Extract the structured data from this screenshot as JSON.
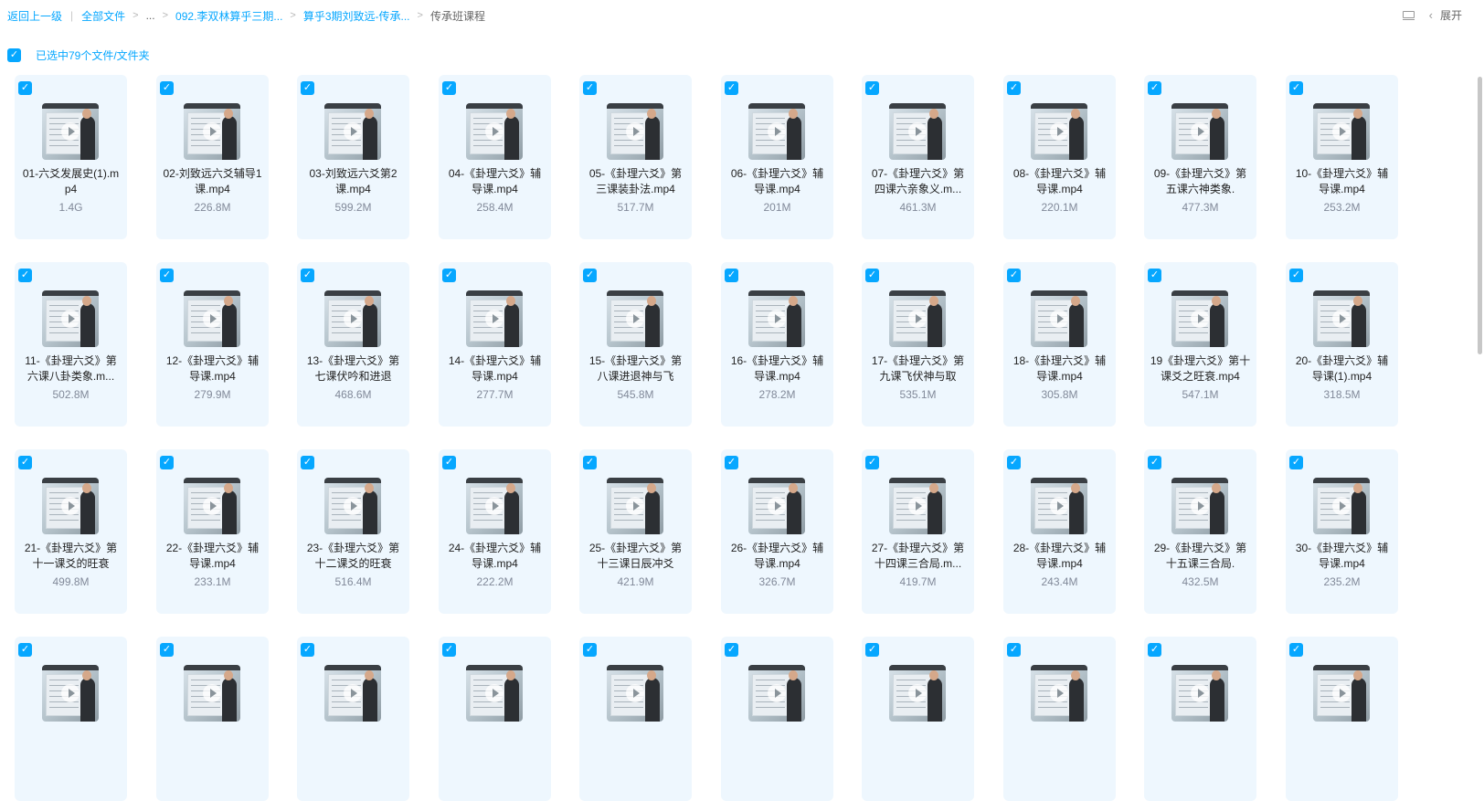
{
  "breadcrumb": {
    "back": "返回上一级",
    "root": "全部文件",
    "ellipsis": "...",
    "crumb1": "092.李双林算乎三期...",
    "crumb2": "算乎3期刘致远-传承...",
    "current": "传承班课程"
  },
  "toolbar": {
    "expand_label": "展开",
    "chevron": "‹",
    "check_mark": "✓"
  },
  "selection": {
    "label": "已选中79个文件/文件夹"
  },
  "files": [
    {
      "name": "01-六爻发展史(1).mp4",
      "size": "1.4G"
    },
    {
      "name": "02-刘致远六爻辅导1课.mp4",
      "size": "226.8M"
    },
    {
      "name": "03-刘致远六爻第2课.mp4",
      "size": "599.2M"
    },
    {
      "name": "04-《卦理六爻》辅导课.mp4",
      "size": "258.4M"
    },
    {
      "name": "05-《卦理六爻》第三课装卦法.mp4",
      "size": "517.7M"
    },
    {
      "name": "06-《卦理六爻》辅导课.mp4",
      "size": "201M"
    },
    {
      "name": "07-《卦理六爻》第四课六亲象义.m...",
      "size": "461.3M"
    },
    {
      "name": "08-《卦理六爻》辅导课.mp4",
      "size": "220.1M"
    },
    {
      "name": "09-《卦理六爻》第五课六神类象.",
      "size": "477.3M"
    },
    {
      "name": "10-《卦理六爻》辅导课.mp4",
      "size": "253.2M"
    },
    {
      "name": "11-《卦理六爻》第六课八卦类象.m...",
      "size": "502.8M"
    },
    {
      "name": "12-《卦理六爻》辅导课.mp4",
      "size": "279.9M"
    },
    {
      "name": "13-《卦理六爻》第七课伏吟和进退",
      "size": "468.6M"
    },
    {
      "name": "14-《卦理六爻》辅导课.mp4",
      "size": "277.7M"
    },
    {
      "name": "15-《卦理六爻》第八课进退神与飞",
      "size": "545.8M"
    },
    {
      "name": "16-《卦理六爻》辅导课.mp4",
      "size": "278.2M"
    },
    {
      "name": "17-《卦理六爻》第九课飞伏神与取",
      "size": "535.1M"
    },
    {
      "name": "18-《卦理六爻》辅导课.mp4",
      "size": "305.8M"
    },
    {
      "name": "19《卦理六爻》第十课爻之旺衰.mp4",
      "size": "547.1M"
    },
    {
      "name": "20-《卦理六爻》辅导课(1).mp4",
      "size": "318.5M"
    },
    {
      "name": "21-《卦理六爻》第十一课爻的旺衰",
      "size": "499.8M"
    },
    {
      "name": "22-《卦理六爻》辅导课.mp4",
      "size": "233.1M"
    },
    {
      "name": "23-《卦理六爻》第十二课爻的旺衰",
      "size": "516.4M"
    },
    {
      "name": "24-《卦理六爻》辅导课.mp4",
      "size": "222.2M"
    },
    {
      "name": "25-《卦理六爻》第十三课日辰冲爻",
      "size": "421.9M"
    },
    {
      "name": "26-《卦理六爻》辅导课.mp4",
      "size": "326.7M"
    },
    {
      "name": "27-《卦理六爻》第十四课三合局.m...",
      "size": "419.7M"
    },
    {
      "name": "28-《卦理六爻》辅导课.mp4",
      "size": "243.4M"
    },
    {
      "name": "29-《卦理六爻》第十五课三合局.",
      "size": "432.5M"
    },
    {
      "name": "30-《卦理六爻》辅导课.mp4",
      "size": "235.2M"
    },
    {
      "name": "",
      "size": ""
    },
    {
      "name": "",
      "size": ""
    },
    {
      "name": "",
      "size": ""
    },
    {
      "name": "",
      "size": ""
    },
    {
      "name": "",
      "size": ""
    },
    {
      "name": "",
      "size": ""
    },
    {
      "name": "",
      "size": ""
    },
    {
      "name": "",
      "size": ""
    },
    {
      "name": "",
      "size": ""
    },
    {
      "name": "",
      "size": ""
    }
  ]
}
